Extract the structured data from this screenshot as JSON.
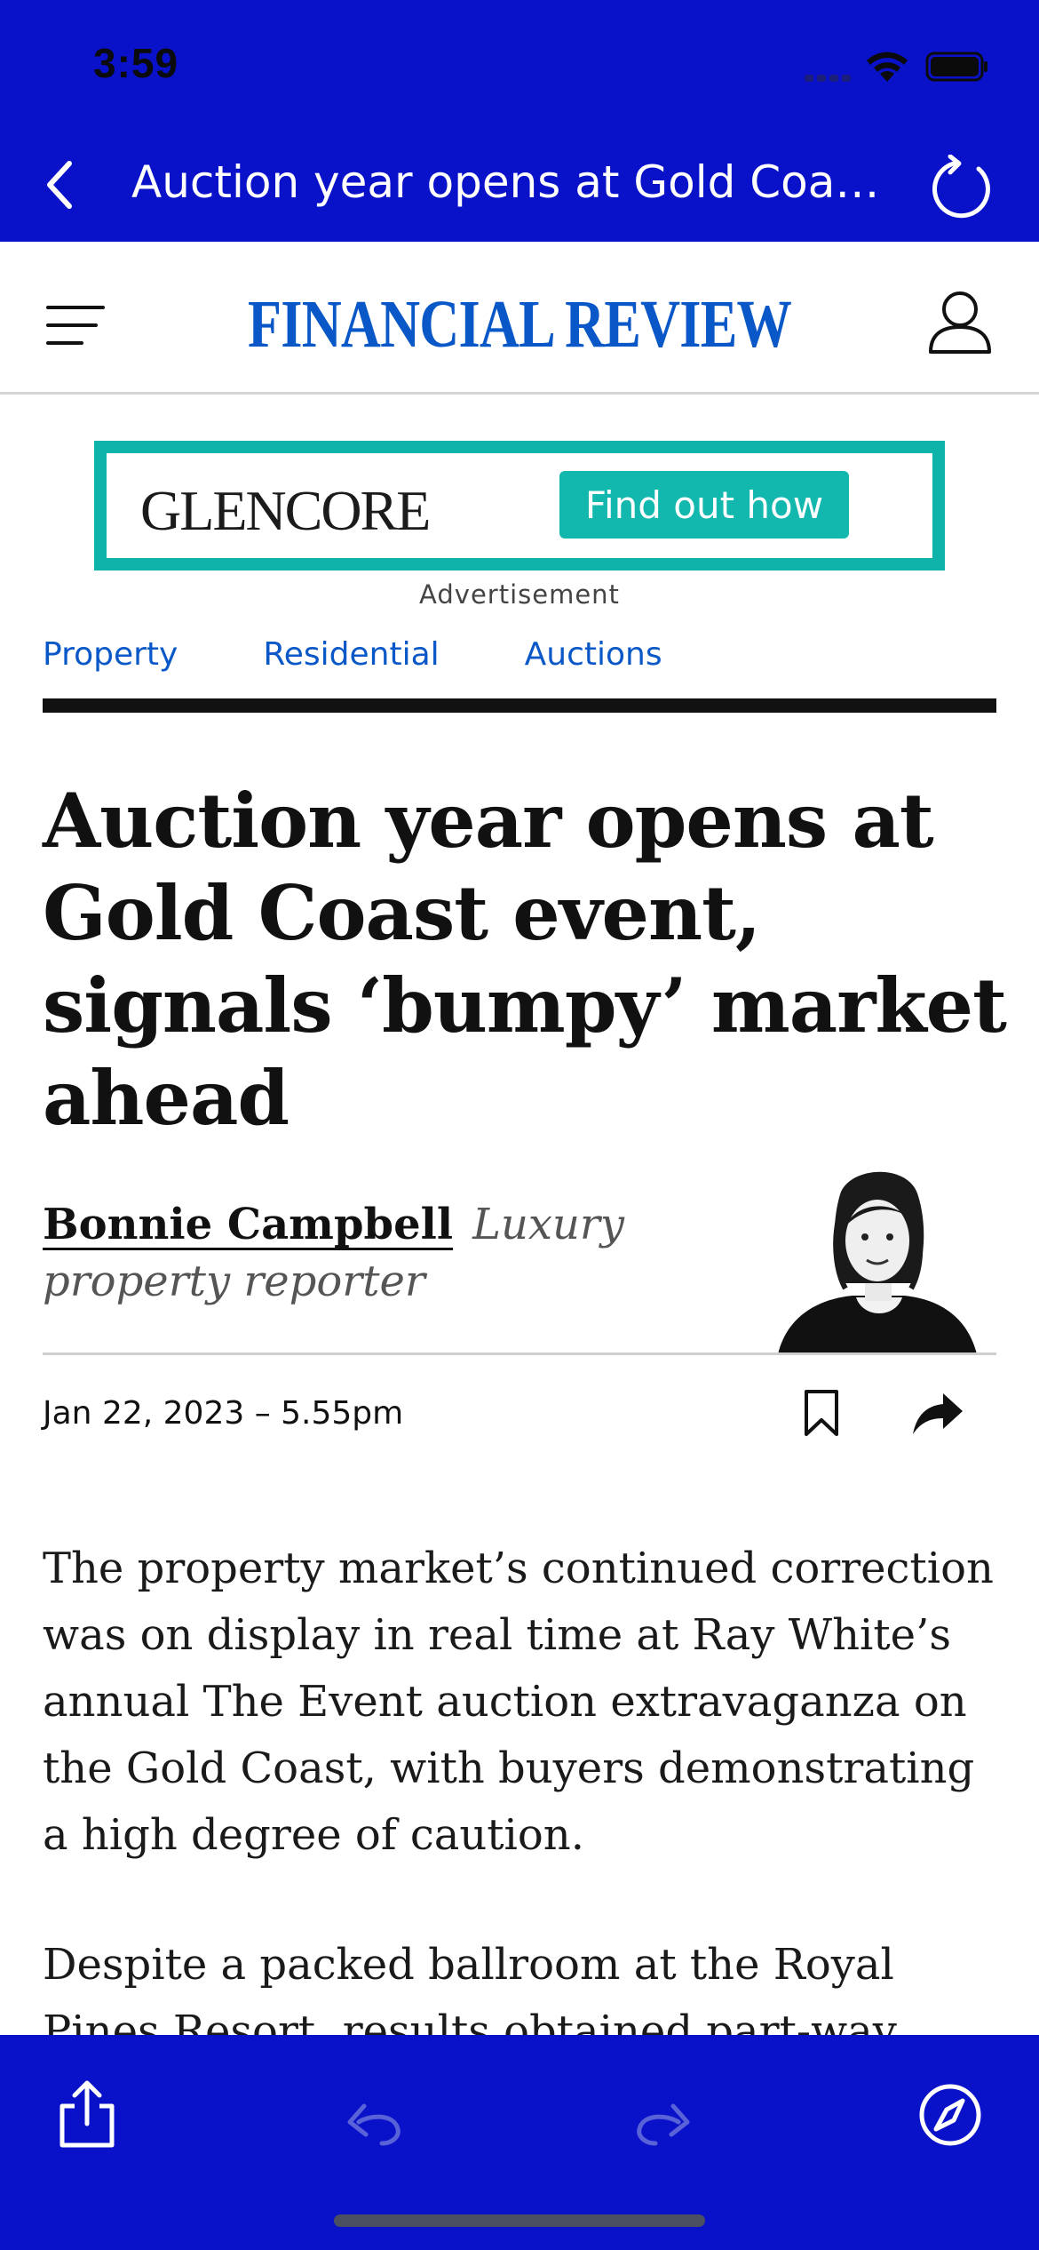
{
  "status_bar": {
    "time": "3:59"
  },
  "browser": {
    "title": "Auction year opens at Gold Coast event, signals ‘bumpy’ market ahead",
    "back_icon": "chevron-left-icon",
    "reload_icon": "reload-icon"
  },
  "site": {
    "masthead": "FINANCIAL REVIEW",
    "brand_color": "#0a58c8"
  },
  "ad": {
    "logo": "GLENCORE",
    "cta": "Find out how",
    "label": "Advertisement",
    "accent": "#0fb3a9"
  },
  "breadcrumbs": [
    "Property",
    "Residential",
    "Auctions"
  ],
  "article": {
    "headline": "Auction year opens at Gold Coast event, signals ‘bumpy’ market ahead",
    "author": "Bonnie Campbell",
    "author_role": "Luxury property reporter",
    "date": "Jan 22, 2023 – 5.55pm",
    "paragraphs": [
      "The property market’s continued correction was on display in real time at Ray White’s annual The Event auction extravaganza on the Gold Coast, with buyers demonstrating a high degree of caution.",
      "Despite a packed ballroom at the Royal Pines Resort, results obtained part-way through"
    ]
  },
  "toolbar": {
    "share_icon": "share-icon",
    "back_icon": "undo-arrow-icon",
    "forward_icon": "redo-arrow-icon",
    "safari_icon": "compass-icon",
    "bar_color": "#0a12c9"
  }
}
